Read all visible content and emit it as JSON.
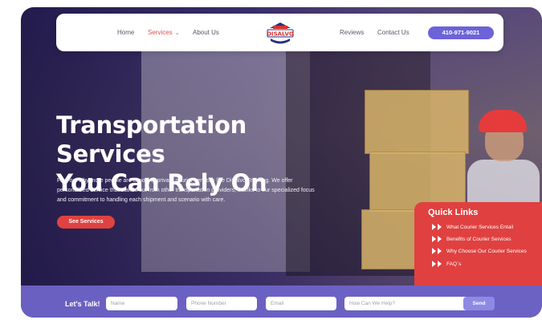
{
  "nav": {
    "home": "Home",
    "services": "Services",
    "about": "About Us",
    "logo_text": "DISALVO",
    "reviews": "Reviews",
    "contact": "Contact Us",
    "phone": "410-971-9021"
  },
  "hero": {
    "title_line1": "Transportation Services",
    "title_line2": "You Can Rely On",
    "body": "Find out why more people are choosing private courier services like DiSalvo Trucking. We offer personalized service that stands out from other transportation providers, thanks to our specialized focus and commitment to handling each shipment and scenario with care.",
    "cta": "See Services"
  },
  "quick_links": {
    "title": "Quick Links",
    "items": [
      "What Courier Services Entail",
      "Benefits of Courier Services",
      "Why Choose Our Courier Services",
      "FAQ`s"
    ]
  },
  "lets_talk": {
    "label": "Let's Talk!",
    "name_placeholder": "Name",
    "phone_placeholder": "Phone Number",
    "email_placeholder": "Email",
    "help_placeholder": "How Can We Help?",
    "send": "Send"
  },
  "colors": {
    "accent": "#6c63d8",
    "cta": "#e0423f",
    "quick_links_bg": "#e04040",
    "lets_talk_bg": "#6e64c8"
  }
}
